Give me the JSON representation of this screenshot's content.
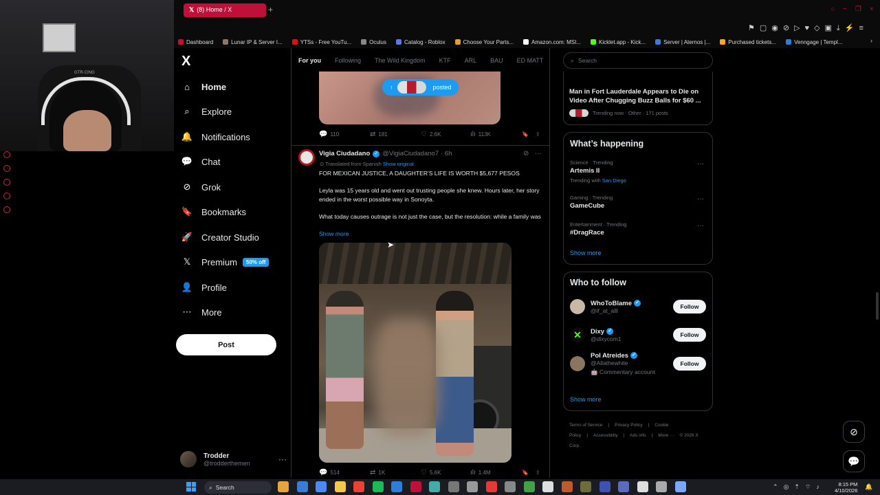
{
  "browser": {
    "tab_title": "(8) Home / X",
    "tab_plus": "+",
    "bookmarks": [
      {
        "label": "Dashboard",
        "color": "#c0103a"
      },
      {
        "label": "Lunar IP & Server I...",
        "color": "#8a7a6a"
      },
      {
        "label": "YTSs - Free YouTu...",
        "color": "#d11"
      },
      {
        "label": "Oculus",
        "color": "#888"
      },
      {
        "label": "Catalog - Roblox",
        "color": "#5c7bd8"
      },
      {
        "label": "Choose Your Parts...",
        "color": "#e0a030"
      },
      {
        "label": "Amazon.com: MSI...",
        "color": "#fff"
      },
      {
        "label": "Kicklet.app - Kick...",
        "color": "#53fc18"
      },
      {
        "label": "Server | Aternos |...",
        "color": "#3a7bd5"
      },
      {
        "label": "Purchased tickets...",
        "color": "#f5a623"
      },
      {
        "label": "Venngage | Templ...",
        "color": "#2e7dd8"
      }
    ],
    "bookmarks_more": "›"
  },
  "webcam": {
    "chair_text": "GTR·CING"
  },
  "nav": {
    "logo": "X",
    "items": [
      {
        "label": "Home",
        "icon": "home-icon",
        "glyph": "⌂"
      },
      {
        "label": "Explore",
        "icon": "search-icon",
        "glyph": "⌕"
      },
      {
        "label": "Notifications",
        "icon": "bell-icon",
        "glyph": "🔔"
      },
      {
        "label": "Chat",
        "icon": "chat-icon",
        "glyph": "💬"
      },
      {
        "label": "Grok",
        "icon": "grok-icon",
        "glyph": "⊘"
      },
      {
        "label": "Bookmarks",
        "icon": "bookmark-icon",
        "glyph": "🔖"
      },
      {
        "label": "Creator Studio",
        "icon": "rocket-icon",
        "glyph": "🚀"
      },
      {
        "label": "Premium",
        "icon": "x-icon",
        "glyph": "𝕏"
      },
      {
        "label": "Profile",
        "icon": "person-icon",
        "glyph": "👤"
      },
      {
        "label": "More",
        "icon": "more-icon",
        "glyph": "⋯"
      }
    ],
    "premium_badge": "50% off",
    "post_label": "Post"
  },
  "account": {
    "name": "Trodder",
    "handle": "@trodderthemen",
    "menu": "···"
  },
  "feed": {
    "tabs": [
      "For you",
      "Following",
      "The Wild Kingdom",
      "KTF",
      "ARL",
      "BAU",
      "ED MATT"
    ],
    "posted_pill": "posted",
    "prev_actions": {
      "replies": "110",
      "reposts": "181",
      "likes": "2.6K",
      "views": "113K"
    },
    "tweet": {
      "name": "Vigia Ciudadano",
      "handle": "@VigiaCiudadano7",
      "time": "· 6h",
      "translated": "Translated from Spanish",
      "show_original": "Show original",
      "p1": "FOR MEXICAN JUSTICE, A DAUGHTER'S LIFE IS WORTH $5,677 PESOS",
      "p2": "Leyla was 15 years old and went out trusting people she knew. Hours later, her story ended in the worst possible way in Sonoyta.",
      "p3": "What today causes outrage is not just the case, but the resolution: while a family was",
      "show_more": "Show more",
      "actions": {
        "replies": "514",
        "reposts": "1K",
        "likes": "5.6K",
        "views": "1.4M"
      }
    }
  },
  "right": {
    "search_placeholder": "Search",
    "news": {
      "headline": "Man in Fort Lauderdale Appears to Die on Video After Chugging Buzz Balls for $60 ...",
      "meta": "Trending now · Other · 171 posts"
    },
    "happening": {
      "title": "What’s happening",
      "trends": [
        {
          "cat": "Science · Trending",
          "name": "Artemis II",
          "extra_prefix": "Trending with ",
          "extra_link": "San Diego"
        },
        {
          "cat": "Gaming · Trending",
          "name": "GameCube"
        },
        {
          "cat": "Entertainment · Trending",
          "name": "#DragRace"
        }
      ],
      "show_more": "Show more"
    },
    "who_to_follow": {
      "title": "Who to follow",
      "accounts": [
        {
          "name": "WhoToBlame",
          "handle": "@if_at_alll",
          "extra": "",
          "follow": "Follow",
          "avatar_color": "#c9b8a5"
        },
        {
          "name": "Dixy",
          "handle": "@dixycom1",
          "extra": "",
          "follow": "Follow",
          "avatar_color": "#0b0b0b"
        },
        {
          "name": "Pol Atreides",
          "handle": "@Allathewhite",
          "extra": "🤖 Commentary account",
          "follow": "Follow",
          "avatar_color": "#8a7560"
        }
      ],
      "show_more": "Show more"
    },
    "footer": [
      "Terms of Service",
      "|",
      "Privacy Policy",
      "|",
      "Cookie Policy",
      "|",
      "Accessibility",
      "|",
      "Ads info",
      "|",
      "More ···",
      "© 2026 X Corp."
    ]
  },
  "taskbar": {
    "search": "Search",
    "time": "8:15 PM",
    "date": "4/10/2026",
    "icons": [
      "#e8a33d",
      "#3a7bd5",
      "#4a8af4",
      "#f2c94c",
      "#ea4335",
      "#1db954",
      "#2e7dd8",
      "#c0103a",
      "#4aa",
      "#777",
      "#999",
      "#e53935",
      "#888",
      "#43a047",
      "#ddd",
      "#bf5a2b",
      "#6c6c3c",
      "#3f51b5",
      "#5c6bc0",
      "#ddd",
      "#aaa",
      "#7aa7ff"
    ]
  }
}
